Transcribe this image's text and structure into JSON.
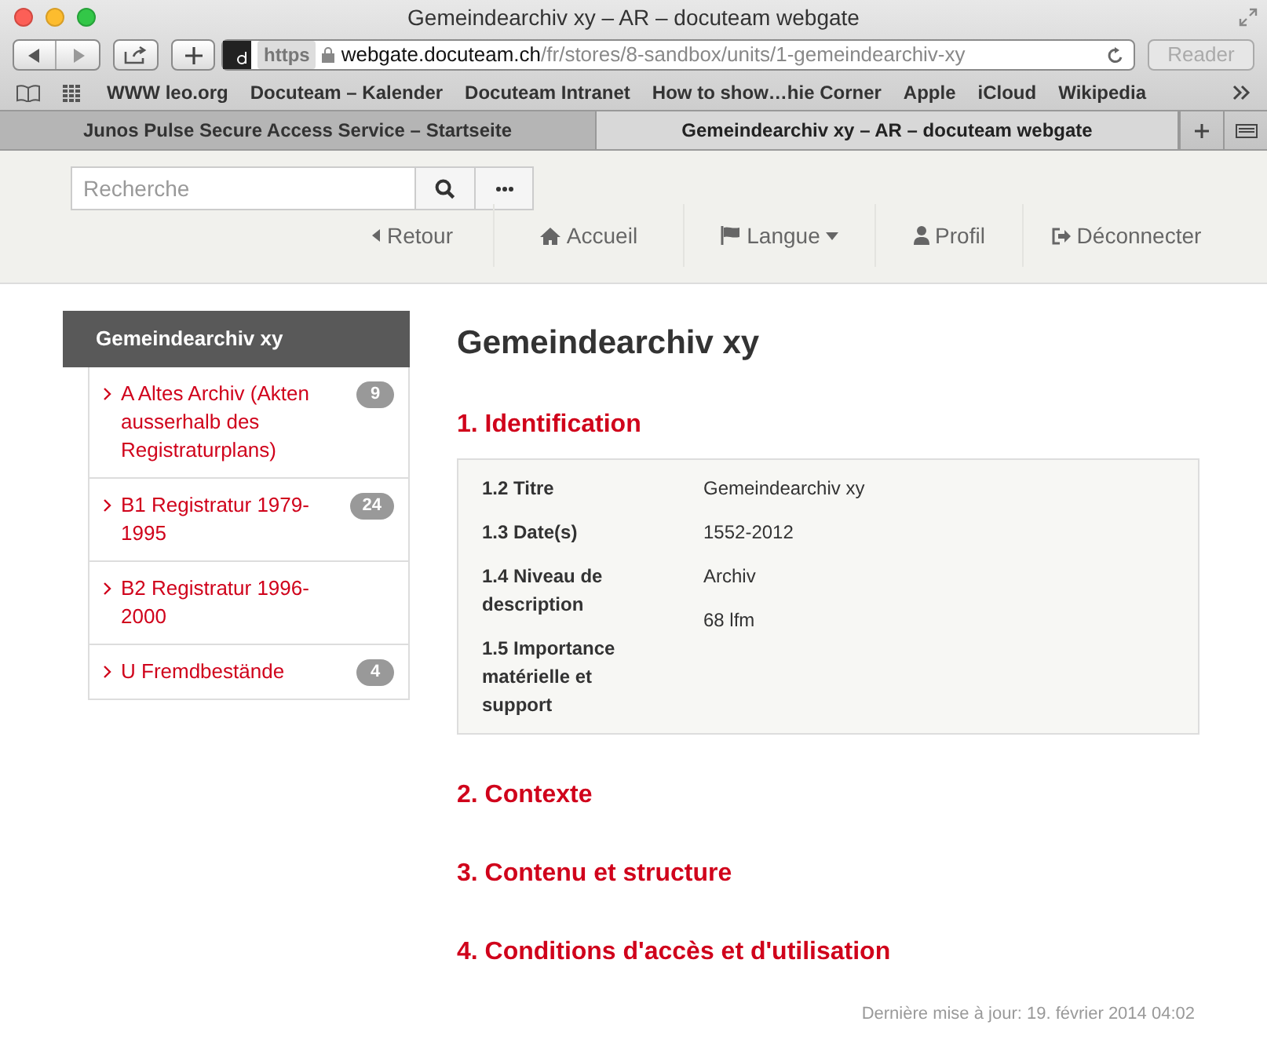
{
  "window": {
    "title": "Gemeindearchiv xy – AR – docuteam webgate"
  },
  "toolbar": {
    "scheme": "https",
    "url_host": "webgate.docuteam.ch",
    "url_path": "/fr/stores/8-sandbox/units/1-gemeindearchiv-xy",
    "reader": "Reader"
  },
  "bookmarks": [
    "WWW leo.org",
    "Docuteam – Kalender",
    "Docuteam Intranet",
    "How to show…hie Corner",
    "Apple",
    "iCloud",
    "Wikipedia"
  ],
  "tabs": [
    {
      "label": "Junos Pulse Secure Access Service – Startseite",
      "selected": false
    },
    {
      "label": "Gemeindearchiv xy – AR – docuteam webgate",
      "selected": true
    }
  ],
  "search": {
    "placeholder": "Recherche"
  },
  "nav": [
    {
      "kind": "back",
      "label": "Retour"
    },
    {
      "kind": "home",
      "label": "Accueil"
    },
    {
      "kind": "language",
      "label": "Langue"
    },
    {
      "kind": "profile",
      "label": "Profil"
    },
    {
      "kind": "logout",
      "label": "Déconnecter"
    }
  ],
  "sidebar": {
    "title": "Gemeindearchiv xy",
    "items": [
      {
        "label": "A Altes Archiv (Akten ausserhalb des Registraturplans)",
        "count": "9"
      },
      {
        "label": "B1 Registratur 1979-1995",
        "count": "24"
      },
      {
        "label": "B2 Registratur 1996-2000"
      },
      {
        "label": "U Fremdbestände",
        "count": "4"
      }
    ]
  },
  "main": {
    "title": "Gemeindearchiv xy",
    "sections": [
      {
        "heading": "1. Identification",
        "labels": [
          "1.2 Titre",
          "1.3 Date(s)",
          "1.4 Niveau de description",
          "1.5 Importance matérielle et support"
        ],
        "values": [
          "Gemeindearchiv xy",
          "1552-2012",
          "Archiv",
          "68 lfm"
        ]
      },
      {
        "heading": "2. Contexte"
      },
      {
        "heading": "3. Contenu et structure"
      },
      {
        "heading": "4. Conditions d'accès et d'utilisation"
      }
    ]
  },
  "footer": "Dernière mise à jour: 19. février 2014 04:02"
}
